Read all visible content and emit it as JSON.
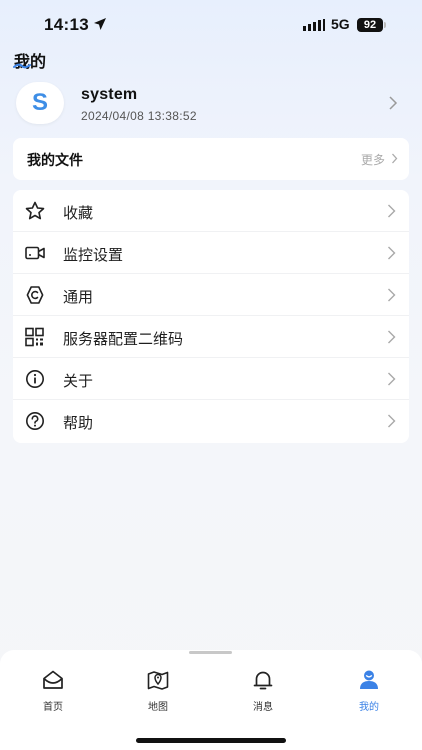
{
  "status_bar": {
    "time": "14:13",
    "network": "5G",
    "battery": "92",
    "icons": [
      "location-arrow-icon",
      "signal-bars-icon"
    ]
  },
  "page": {
    "title": "我的"
  },
  "profile": {
    "avatar_letter": "S",
    "username": "system",
    "login_time": "2024/04/08 13:38:52"
  },
  "files": {
    "title": "我的文件",
    "more": "更多"
  },
  "menu": [
    {
      "label": "收藏",
      "icon": "star-icon"
    },
    {
      "label": "监控设置",
      "icon": "camera-icon"
    },
    {
      "label": "通用",
      "icon": "settings-icon"
    },
    {
      "label": "服务器配置二维码",
      "icon": "qr-code-icon"
    },
    {
      "label": "关于",
      "icon": "info-icon"
    },
    {
      "label": "帮助",
      "icon": "help-icon"
    }
  ],
  "tabs": [
    {
      "label": "首页",
      "icon": "home-icon"
    },
    {
      "label": "地图",
      "icon": "map-icon"
    },
    {
      "label": "消息",
      "icon": "bell-icon"
    },
    {
      "label": "我的",
      "icon": "user-icon",
      "active": true
    }
  ],
  "colors": {
    "accent": "#3b82e6",
    "avatar_text": "#3e8ee6"
  }
}
